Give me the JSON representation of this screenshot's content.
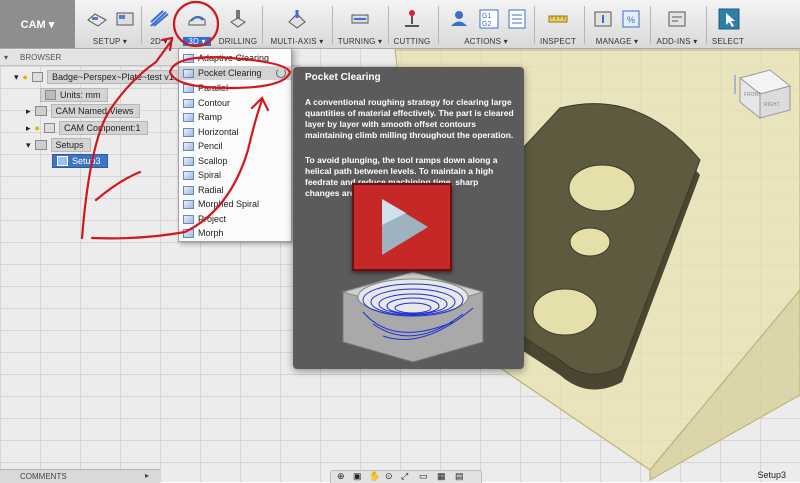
{
  "toolbar": {
    "workspace": "CAM ▾",
    "groups": {
      "setup": "SETUP ▾",
      "two_d": "2D ▾",
      "three_d": "3D ▾",
      "drilling": "DRILLING",
      "multi_axis": "MULTI-AXIS ▾",
      "turning": "TURNING ▾",
      "cutting": "CUTTING",
      "actions": "ACTIONS ▾",
      "inspect": "INSPECT",
      "manage": "MANAGE ▾",
      "addins": "ADD-INS ▾",
      "select": "SELECT"
    },
    "g1g2": "G1\nG2"
  },
  "browser": {
    "title": "BROWSER",
    "items": [
      {
        "label": "Badge~Perspex~Plate~test v1"
      },
      {
        "label": "Units: mm"
      },
      {
        "label": "CAM Named Views"
      },
      {
        "label": "CAM Component:1"
      },
      {
        "label": "Setups"
      },
      {
        "label": "Setup3"
      }
    ]
  },
  "menu": {
    "items": [
      {
        "label": "Adaptive Clearing"
      },
      {
        "label": "Pocket Clearing"
      },
      {
        "label": "Parallel"
      },
      {
        "label": "Contour"
      },
      {
        "label": "Ramp"
      },
      {
        "label": "Horizontal"
      },
      {
        "label": "Pencil"
      },
      {
        "label": "Scallop"
      },
      {
        "label": "Spiral"
      },
      {
        "label": "Radial"
      },
      {
        "label": "Morphed Spiral"
      },
      {
        "label": "Project"
      },
      {
        "label": "Morph"
      }
    ]
  },
  "tooltip": {
    "title": "Pocket Clearing",
    "p1": "A conventional roughing strategy for clearing large quantities of material effectively. The part is cleared layer by layer with smooth offset contours maintaining climb milling throughout the operation.",
    "p2": "To avoid plunging, the tool ramps down along a helical path between levels. To maintain a high feedrate and reduce machining time, sharp changes are avoided by smoothing"
  },
  "viewcube": {
    "front": "FRONT",
    "right": "RIGHT"
  },
  "bottom": {
    "comments": "COMMENTS",
    "status": "Setup3"
  },
  "colors": {
    "accent": "#2f6fd0",
    "play": "#c62828",
    "annotation": "#d0191e",
    "stock": "#e6e0a8"
  }
}
